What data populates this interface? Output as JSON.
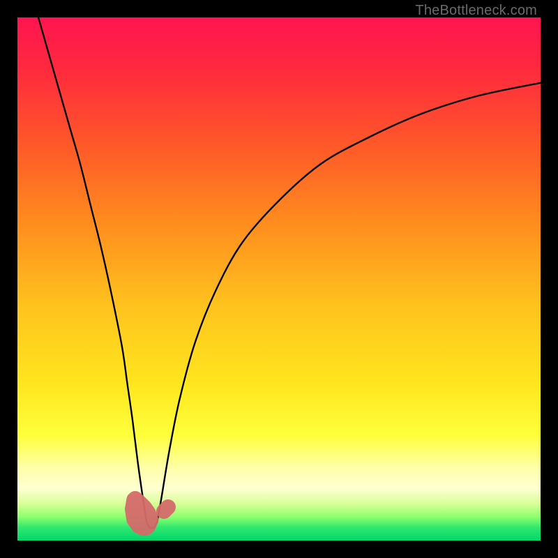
{
  "watermark": "TheBottleneck.com",
  "chart_data": {
    "type": "line",
    "title": "",
    "xlabel": "",
    "ylabel": "",
    "xlim": [
      0,
      100
    ],
    "ylim": [
      0,
      100
    ],
    "grid": false,
    "series": [
      {
        "name": "gradient-background",
        "kind": "vertical-gradient",
        "stops": [
          {
            "pos": 0.0,
            "color": "#ff1450"
          },
          {
            "pos": 0.1,
            "color": "#ff2a3e"
          },
          {
            "pos": 0.25,
            "color": "#ff5a28"
          },
          {
            "pos": 0.4,
            "color": "#ff8f1e"
          },
          {
            "pos": 0.55,
            "color": "#ffc21e"
          },
          {
            "pos": 0.7,
            "color": "#ffe61e"
          },
          {
            "pos": 0.8,
            "color": "#ffff3c"
          },
          {
            "pos": 0.86,
            "color": "#ffffa8"
          },
          {
            "pos": 0.9,
            "color": "#ffffd2"
          },
          {
            "pos": 0.93,
            "color": "#d8ff96"
          },
          {
            "pos": 0.955,
            "color": "#8cff6e"
          },
          {
            "pos": 0.975,
            "color": "#30e86e"
          },
          {
            "pos": 1.0,
            "color": "#00d76a"
          }
        ]
      },
      {
        "name": "left-branch",
        "kind": "curve",
        "x": [
          4,
          6,
          8,
          10,
          12,
          14,
          16,
          18,
          20,
          21,
          22,
          23,
          24,
          24.7
        ],
        "values": [
          100,
          93,
          86,
          79,
          72,
          64,
          56,
          47,
          37,
          30,
          23,
          15,
          8,
          3.5
        ]
      },
      {
        "name": "right-branch",
        "kind": "curve",
        "x": [
          26.7,
          27.5,
          29,
          31,
          34,
          38,
          43,
          50,
          58,
          67,
          77,
          88,
          100
        ],
        "values": [
          3.5,
          8,
          17,
          27,
          38,
          48,
          57,
          65,
          72,
          77,
          81.5,
          85,
          87.5
        ]
      },
      {
        "name": "valley-floor",
        "kind": "curve",
        "x": [
          24.7,
          25.2,
          25.7,
          26.2,
          26.7
        ],
        "values": [
          3.5,
          2.6,
          2.4,
          2.6,
          3.5
        ]
      },
      {
        "name": "highlight-blob-left",
        "kind": "marker",
        "color": "#d46a6a",
        "x": [
          22.3,
          22.0,
          22.3,
          23.2,
          24.0,
          24.5,
          25.0,
          25.5,
          25.0,
          24.3,
          23.2,
          22.5
        ],
        "values": [
          7.8,
          6.0,
          4.0,
          2.8,
          2.4,
          2.4,
          2.8,
          4.0,
          5.3,
          6.3,
          7.4,
          8.0
        ]
      },
      {
        "name": "highlight-blob-right",
        "kind": "marker",
        "color": "#d46a6a",
        "x": [
          28.0,
          28.8
        ],
        "values": [
          5.6,
          6.4
        ]
      }
    ]
  }
}
